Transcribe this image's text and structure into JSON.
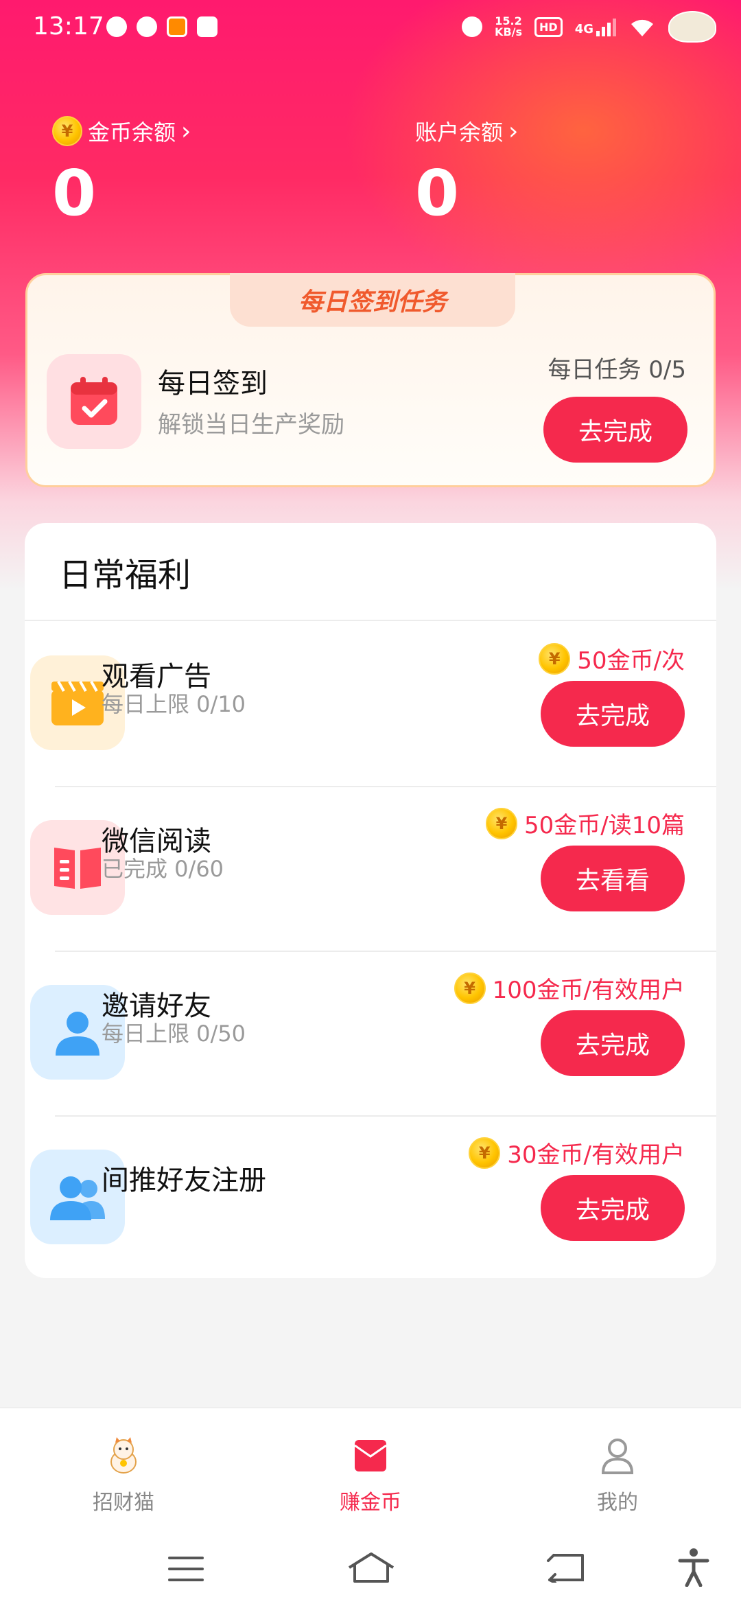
{
  "status_bar": {
    "time": "13:17",
    "net_speed_value": "15.2",
    "net_speed_unit": "KB/s",
    "hd": "HD",
    "network": "4G",
    "icons": [
      "qq-icon",
      "check-circle-icon",
      "app-icon",
      "alipay-icon",
      "alarm-icon",
      "wifi-icon",
      "cake-icon"
    ]
  },
  "balance": {
    "coin_label": "金币余额",
    "coin_value": "0",
    "account_label": "账户余额",
    "account_value": "0",
    "coin_symbol": "¥"
  },
  "sign_in": {
    "banner": "每日签到任务",
    "title": "每日签到",
    "subtitle": "解锁当日生产奖励",
    "daily_tasks": "每日任务 0/5",
    "button": "去完成"
  },
  "welfare": {
    "heading": "日常福利",
    "tasks": [
      {
        "title": "观看广告",
        "subtitle": "每日上限 0/10",
        "reward": "50金币/次",
        "button": "去完成",
        "icon": "video-icon"
      },
      {
        "title": "微信阅读",
        "subtitle": "已完成 0/60",
        "reward": "50金币/读10篇",
        "button": "去看看",
        "icon": "book-icon"
      },
      {
        "title": "邀请好友",
        "subtitle": "每日上限 0/50",
        "reward": "100金币/有效用户",
        "button": "去完成",
        "icon": "user-icon"
      },
      {
        "title": "间推好友注册",
        "subtitle": "",
        "reward": "30金币/有效用户",
        "button": "去完成",
        "icon": "users-icon"
      }
    ]
  },
  "bottom_nav": {
    "items": [
      {
        "label": "招财猫",
        "icon": "lucky-cat-icon",
        "active": false
      },
      {
        "label": "赚金币",
        "icon": "red-envelope-icon",
        "active": true
      },
      {
        "label": "我的",
        "icon": "profile-icon",
        "active": false
      }
    ]
  },
  "colors": {
    "accent": "#f5294d",
    "hero_top": "#ff1a6e",
    "coin": "#ffc400"
  }
}
